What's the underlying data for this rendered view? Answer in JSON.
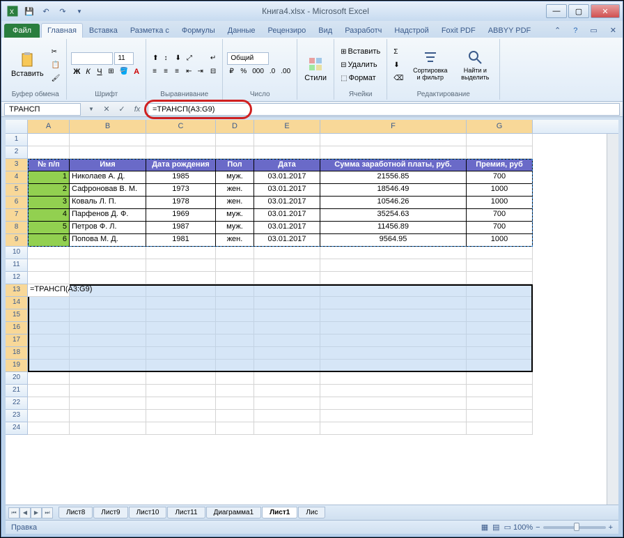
{
  "window": {
    "title": "Книга4.xlsx - Microsoft Excel"
  },
  "qat": {
    "save": "save",
    "undo": "undo",
    "redo": "redo"
  },
  "tabs": {
    "file": "Файл",
    "home": "Главная",
    "insert": "Вставка",
    "layout": "Разметка с",
    "formulas": "Формулы",
    "data": "Данные",
    "review": "Рецензиро",
    "view": "Вид",
    "dev": "Разработч",
    "addins": "Надстрой",
    "foxit": "Foxit PDF",
    "abbyy": "ABBYY PDF"
  },
  "ribbon": {
    "clipboard": {
      "label": "Буфер обмена",
      "paste": "Вставить"
    },
    "font": {
      "label": "Шрифт",
      "size": "11"
    },
    "align": {
      "label": "Выравнивание"
    },
    "number": {
      "label": "Число",
      "fmt": "Общий"
    },
    "styles": {
      "label": "",
      "btn": "Стили"
    },
    "cells": {
      "label": "Ячейки",
      "insert": "Вставить",
      "delete": "Удалить",
      "format": "Формат"
    },
    "editing": {
      "label": "Редактирование",
      "sort": "Сортировка и фильтр",
      "find": "Найти и выделить"
    }
  },
  "namebox": "ТРАНСП",
  "formula": "=ТРАНСП(A3:G9)",
  "columns": [
    "A",
    "B",
    "C",
    "D",
    "E",
    "F",
    "G"
  ],
  "table": {
    "headers": [
      "№ п/п",
      "Имя",
      "Дата рождения",
      "Пол",
      "Дата",
      "Сумма заработной платы, руб.",
      "Премия, руб"
    ],
    "rows": [
      [
        "1",
        "Николаев А. Д.",
        "1985",
        "муж.",
        "03.01.2017",
        "21556.85",
        "700"
      ],
      [
        "2",
        "Сафроновав В. М.",
        "1973",
        "жен.",
        "03.01.2017",
        "18546.49",
        "1000"
      ],
      [
        "3",
        "Коваль Л. П.",
        "1978",
        "жен.",
        "03.01.2017",
        "10546.26",
        "1000"
      ],
      [
        "4",
        "Парфенов Д. Ф.",
        "1969",
        "муж.",
        "03.01.2017",
        "35254.63",
        "700"
      ],
      [
        "5",
        "Петров Ф. Л.",
        "1987",
        "муж.",
        "03.01.2017",
        "11456.89",
        "700"
      ],
      [
        "6",
        "Попова М. Д.",
        "1981",
        "жен.",
        "03.01.2017",
        "9564.95",
        "1000"
      ]
    ]
  },
  "cell_input": "=ТРАНСП(A3:G9)",
  "sheets": [
    "Лист8",
    "Лист9",
    "Лист10",
    "Лист11",
    "Диаграмма1",
    "Лист1",
    "Лис"
  ],
  "active_sheet": "Лист1",
  "status": {
    "mode": "Правка",
    "zoom": "100%"
  }
}
